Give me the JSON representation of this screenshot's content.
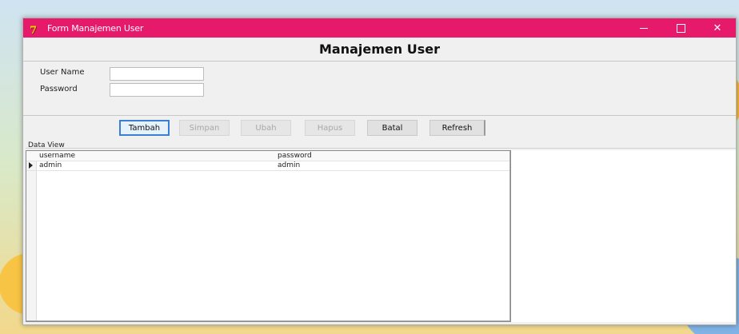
{
  "window": {
    "title": "Form Manajemen User",
    "icon_glyph": "7",
    "title_bar_color": "#e6196a"
  },
  "header": {
    "title": "Manajemen User"
  },
  "form": {
    "user_name_label": "User Name",
    "password_label": "Password",
    "user_name_value": "",
    "password_value": ""
  },
  "buttons": {
    "tambah": "Tambah",
    "simpan": "Simpan",
    "ubah": "Ubah",
    "hapus": "Hapus",
    "batal": "Batal",
    "refresh": "Refresh"
  },
  "data_view": {
    "label": "Data View",
    "columns": [
      "username",
      "password"
    ],
    "rows": [
      [
        "admin",
        "admin"
      ]
    ]
  }
}
